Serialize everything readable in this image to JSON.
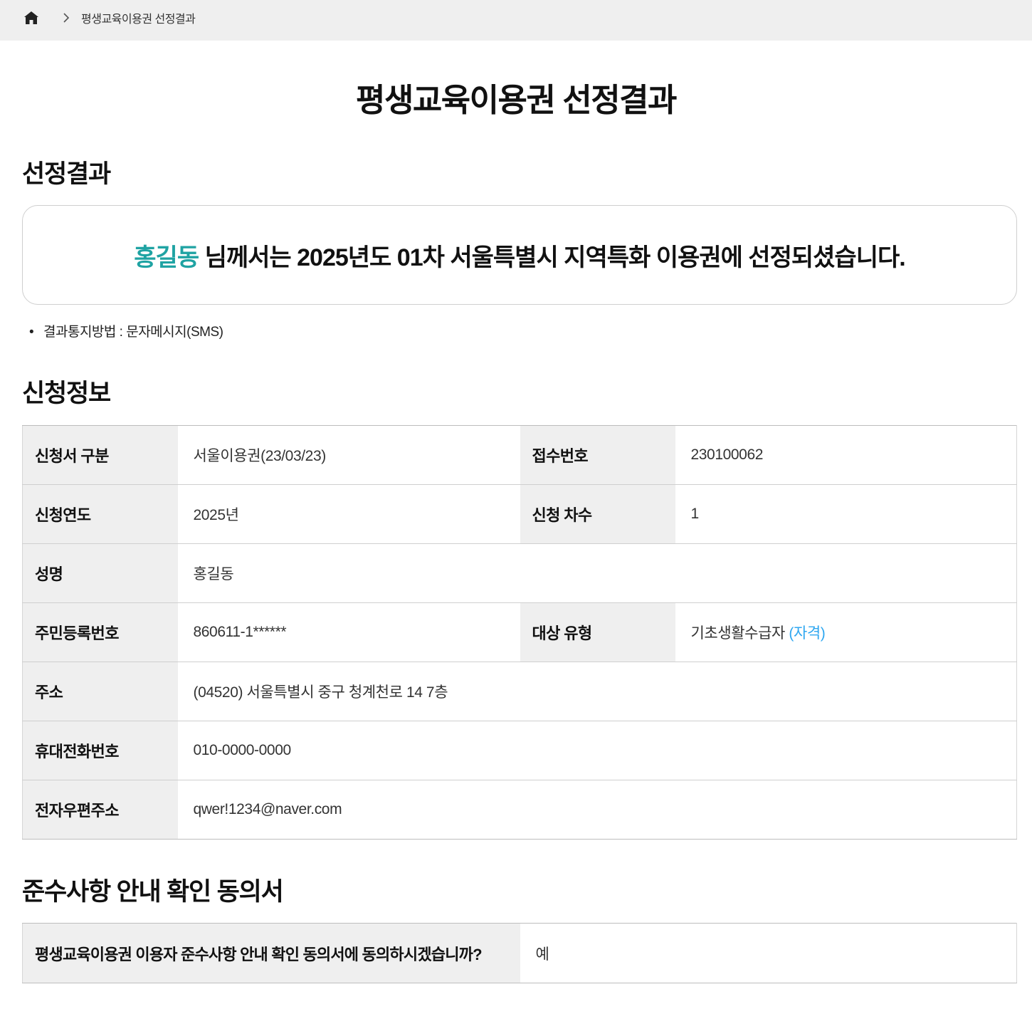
{
  "breadcrumb": {
    "home_icon": "home-icon",
    "separator_icon": "chevron-right-icon",
    "current": "평생교육이용권 선정결과"
  },
  "page_title": "평생교육이용권 선정결과",
  "result_section": {
    "title": "선정결과",
    "name": "홍길동",
    "message": " 님께서는 2025년도 01차 서울특별시 지역특화 이용권에 선정되셨습니다.",
    "name_color": "#1fa3a3",
    "note_bullet": "•",
    "note": "결과통지방법 : 문자메시지(SMS)"
  },
  "application_section": {
    "title": "신청정보",
    "fields": {
      "type_label": "신청서 구분",
      "type_value": "서울이용권(23/03/23)",
      "receipt_label": "접수번호",
      "receipt_value": "230100062",
      "year_label": "신청연도",
      "year_value": "2025년",
      "round_label": "신청 차수",
      "round_value": "1",
      "name_label": "성명",
      "name_value": "홍길동",
      "rrn_label": "주민등록번호",
      "rrn_value": "860611-1******",
      "target_label": "대상 유형",
      "target_value": "기초생활수급자 ",
      "target_qualifier": "(자격)",
      "address_label": "주소",
      "address_value": "(04520) 서울특별시 중구 청계천로 14 7층",
      "phone_label": "휴대전화번호",
      "phone_value": "010-0000-0000",
      "email_label": "전자우편주소",
      "email_value": "qwer!1234@naver.com"
    }
  },
  "agreement_section": {
    "title": "준수사항 안내 확인 동의서",
    "question": "평생교육이용권 이용자 준수사항 안내 확인 동의서에 동의하시겠습니까?",
    "answer": "예"
  },
  "colors": {
    "accent": "#1fa3a3",
    "link": "#2fa7f0",
    "header_bg": "#efefef"
  }
}
